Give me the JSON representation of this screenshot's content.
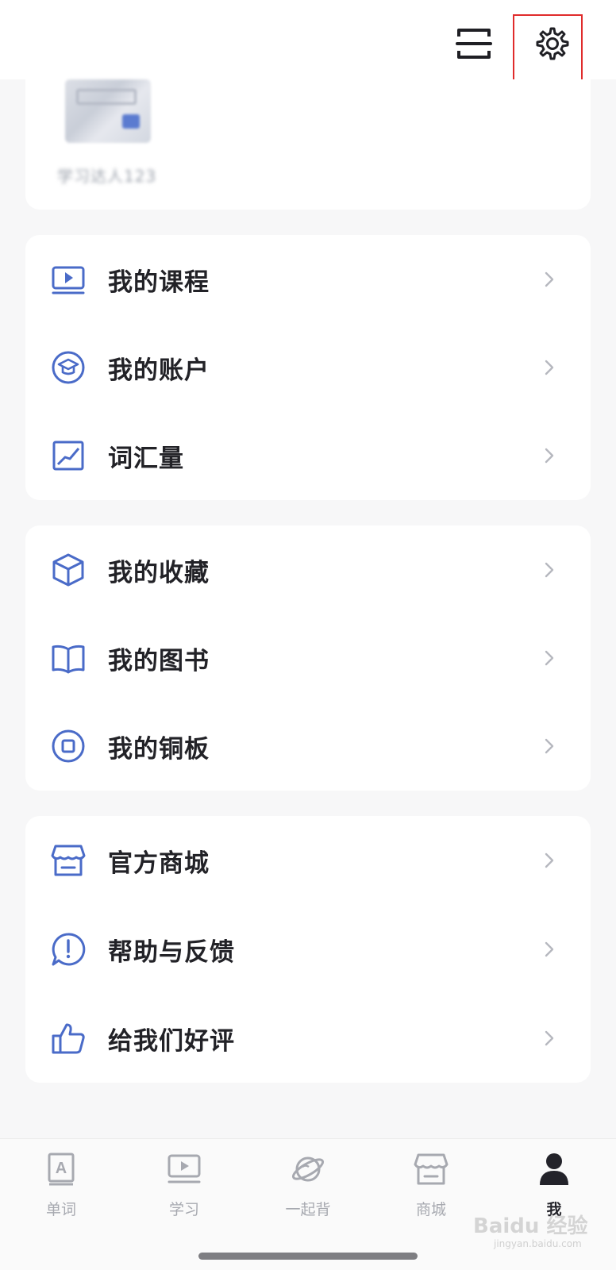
{
  "header": {
    "scan_icon": "scan-icon",
    "settings_icon": "gear-icon"
  },
  "profile": {
    "username": "学习达人123"
  },
  "menu_groups": [
    {
      "items": [
        {
          "label": "我的课程",
          "icon": "course-play-icon"
        },
        {
          "label": "我的账户",
          "icon": "graduation-cap-icon"
        },
        {
          "label": "词汇量",
          "icon": "trend-chart-icon"
        }
      ]
    },
    {
      "items": [
        {
          "label": "我的收藏",
          "icon": "cube-icon"
        },
        {
          "label": "我的图书",
          "icon": "book-icon"
        },
        {
          "label": "我的铜板",
          "icon": "coin-icon"
        }
      ]
    },
    {
      "items": [
        {
          "label": "官方商城",
          "icon": "store-icon"
        },
        {
          "label": "帮助与反馈",
          "icon": "feedback-icon"
        },
        {
          "label": "给我们好评",
          "icon": "thumbs-up-icon"
        }
      ]
    }
  ],
  "tabbar": {
    "tabs": [
      {
        "label": "单词",
        "icon": "word-card-icon",
        "active": false
      },
      {
        "label": "学习",
        "icon": "study-play-icon",
        "active": false
      },
      {
        "label": "一起背",
        "icon": "planet-icon",
        "active": false
      },
      {
        "label": "商城",
        "icon": "store-icon",
        "active": false
      },
      {
        "label": "我",
        "icon": "person-icon",
        "active": true
      }
    ]
  },
  "watermark": {
    "text": "Baidu 经验",
    "sub": "jingyan.baidu.com"
  },
  "colors": {
    "accent_icon": "#4a6bc8",
    "annotation_red": "#e02b2b",
    "background": "#f7f7f8"
  }
}
